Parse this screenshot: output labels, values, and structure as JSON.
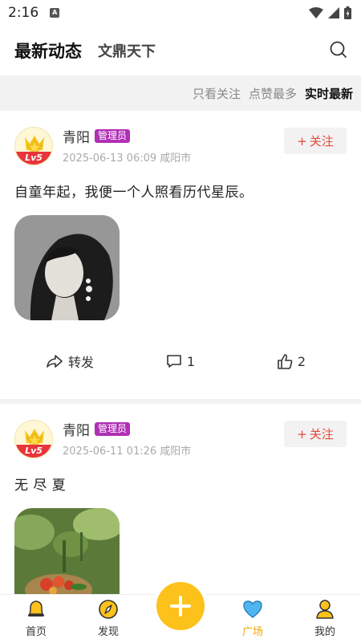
{
  "status_bar": {
    "time": "2:16",
    "notif_label": "A"
  },
  "header": {
    "tab_active": "最新动态",
    "tab_other": "文鼎天下"
  },
  "filters": [
    {
      "label": "只看关注",
      "active": false
    },
    {
      "label": "点赞最多",
      "active": false
    },
    {
      "label": "实时最新",
      "active": true
    }
  ],
  "posts": [
    {
      "user": "青阳",
      "badge": "管理员",
      "level": "Lv5",
      "date": "2025-06-13 06:09",
      "location": "咸阳市",
      "follow_label": "关注",
      "text": "自童年起，我便一个人照看历代星辰。",
      "actions": {
        "share_label": "转发",
        "comments": "1",
        "likes": "2"
      }
    },
    {
      "user": "青阳",
      "badge": "管理员",
      "level": "Lv5",
      "date": "2025-06-11 01:26",
      "location": "咸阳市",
      "follow_label": "关注",
      "text": "无 尽 夏"
    }
  ],
  "bottom_nav": [
    {
      "label": "首页",
      "icon": "bell-icon",
      "active": false
    },
    {
      "label": "发现",
      "icon": "compass-icon",
      "active": false
    },
    {
      "label": "广场",
      "icon": "heart-icon",
      "active": true
    },
    {
      "label": "我的",
      "icon": "user-icon",
      "active": false
    }
  ],
  "colors": {
    "accent": "#fcc11b",
    "badge": "#b02fb5",
    "follow": "#e4483a"
  }
}
